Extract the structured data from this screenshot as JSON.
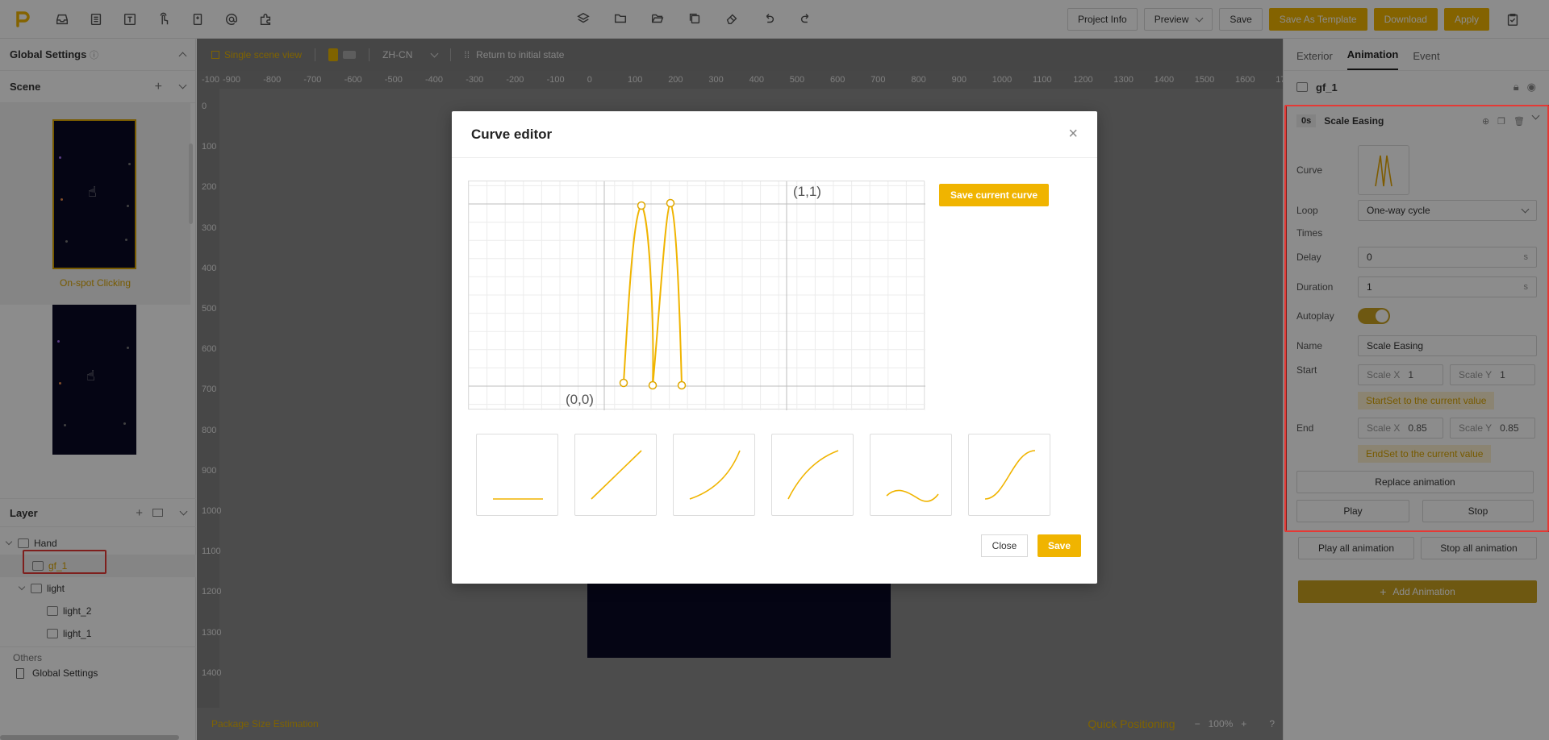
{
  "toolbar": {
    "project_info": "Project Info",
    "preview": "Preview",
    "save": "Save",
    "save_as_template": "Save As Template",
    "download": "Download",
    "apply": "Apply"
  },
  "left": {
    "global_settings": "Global Settings",
    "scene_title": "Scene",
    "scene_label": "On-spot Clicking",
    "layer_title": "Layer",
    "tree": [
      "Hand",
      "gf_1",
      "light",
      "light_2",
      "light_1"
    ],
    "others": "Others",
    "others_item": "Global Settings"
  },
  "canvas": {
    "view_mode": "Single scene view",
    "lang": "ZH-CN",
    "reset": "Return to initial state",
    "ruler_x": [
      "-100",
      "-900",
      "-800",
      "-700",
      "-600",
      "-500",
      "-400",
      "-300",
      "-200",
      "-100",
      "0",
      "100",
      "200",
      "300",
      "400",
      "500",
      "600",
      "700",
      "800",
      "900",
      "1000",
      "1100",
      "1200",
      "1300",
      "1400",
      "1500",
      "1600",
      "17"
    ],
    "ruler_y": [
      "0",
      "100",
      "200",
      "300",
      "400",
      "500",
      "600",
      "700",
      "800",
      "900",
      "1000",
      "1100",
      "1200",
      "1300",
      "1400"
    ],
    "package_size": "Package Size Estimation",
    "quick_pos": "Quick Positioning",
    "zoom": "100%"
  },
  "right": {
    "tabs": [
      "Exterior",
      "Animation",
      "Event"
    ],
    "object": "gf_1",
    "anim": {
      "time": "0s",
      "name_title": "Scale Easing",
      "curve_label": "Curve",
      "loop_label": "Loop",
      "loop_value": "One-way cycle",
      "times_label": "Times",
      "delay_label": "Delay",
      "delay_value": "0",
      "duration_label": "Duration",
      "duration_value": "1",
      "unit": "s",
      "autoplay_label": "Autoplay",
      "name_label": "Name",
      "name_value": "Scale Easing",
      "start_label": "Start",
      "scale_x": "Scale X",
      "scale_y": "Scale Y",
      "start_x": "1",
      "start_y": "1",
      "start_set": "StartSet to the current value",
      "end_label": "End",
      "end_x": "0.85",
      "end_y": "0.85",
      "end_set": "EndSet to the current value",
      "replace": "Replace animation",
      "play": "Play",
      "stop": "Stop"
    },
    "play_all": "Play all animation",
    "stop_all": "Stop all animation",
    "add_anim": "Add Animation"
  },
  "modal": {
    "title": "Curve editor",
    "label_end": "(1,1)",
    "label_origin": "(0,0)",
    "save_current": "Save current curve",
    "close": "Close",
    "save": "Save"
  },
  "colors": {
    "accent": "#f0b400",
    "highlight": "#e53935",
    "stage": "#0a0a26"
  }
}
